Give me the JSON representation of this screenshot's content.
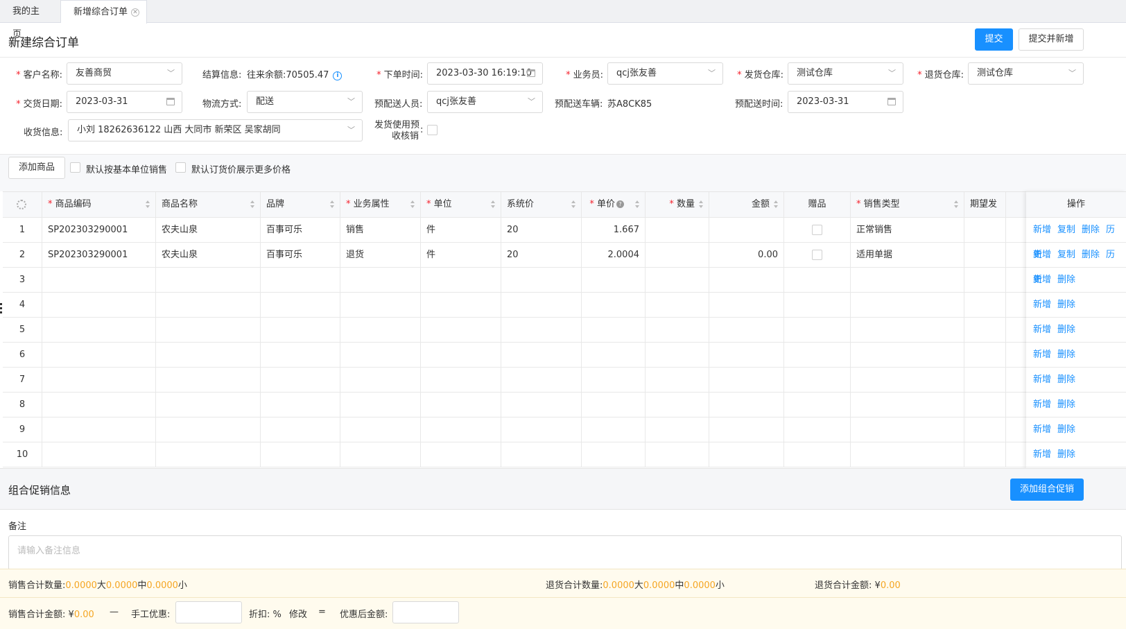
{
  "tabs": [
    {
      "label": "我的主页"
    },
    {
      "label": "新增综合订单",
      "close": "⊗"
    }
  ],
  "header": {
    "title": "新建综合订单",
    "submit_label": "提交",
    "submit_new_label": "提交并新增"
  },
  "form": {
    "customer": {
      "label": "客户名称:",
      "value": "友善商贸"
    },
    "settlement": {
      "label": "结算信息:",
      "value": "往来余额:70505.47"
    },
    "order_time": {
      "label": "下单时间:",
      "value": "2023-03-30 16:19:10"
    },
    "salesperson": {
      "label": "业务员:",
      "value": "qcj张友善"
    },
    "ship_warehouse": {
      "label": "发货仓库:",
      "value": "测试仓库"
    },
    "return_warehouse": {
      "label": "退货仓库:",
      "value": "测试仓库"
    },
    "delivery_date": {
      "label": "交货日期:",
      "value": "2023-03-31"
    },
    "logistics": {
      "label": "物流方式:",
      "value": "配送"
    },
    "delivery_person": {
      "label": "预配送人员:",
      "value": "qcj张友善"
    },
    "vehicle": {
      "label": "预配送车辆:",
      "value": "苏A8CK85"
    },
    "delivery_time": {
      "label": "预配送时间:",
      "value": "2023-03-31"
    },
    "receive_info": {
      "label": "收货信息:",
      "value": "小刘 18262636122 山西 大同市 新荣区 吴家胡同"
    },
    "prepay_label_line1": "发货使用预",
    "prepay_label_line2": "收核销",
    "colon": ":"
  },
  "toolbar": {
    "add_product_label": "添加商品",
    "base_unit_label": "默认按基本单位销售",
    "more_price_label": "默认订货价展示更多价格"
  },
  "table": {
    "headers": {
      "code": "商品编码",
      "name": "商品名称",
      "brand": "品牌",
      "business": "业务属性",
      "unit": "单位",
      "sys_price": "系统价",
      "price": "单价",
      "qty": "数量",
      "amount": "金额",
      "gift": "赠品",
      "sale_type": "销售类型",
      "expect": "期望发",
      "ops": "操作"
    },
    "rows": [
      {
        "no": "1",
        "code": "SP202303290001",
        "name": "农夫山泉",
        "brand": "百事可乐",
        "business": "销售",
        "unit": "件",
        "sys_price": "20",
        "price": "1.667",
        "qty": "",
        "amount": "",
        "sale_type": "正常销售"
      },
      {
        "no": "2",
        "code": "SP202303290001",
        "name": "农夫山泉",
        "brand": "百事可乐",
        "business": "退货",
        "unit": "件",
        "sys_price": "20",
        "price": "2.0004",
        "qty": "",
        "amount": "0.00",
        "sale_type": "适用单据"
      },
      {
        "no": "3"
      },
      {
        "no": "4"
      },
      {
        "no": "5"
      },
      {
        "no": "6"
      },
      {
        "no": "7"
      },
      {
        "no": "8"
      },
      {
        "no": "9"
      },
      {
        "no": "10"
      }
    ],
    "ops": {
      "add": "新增",
      "copy": "复制",
      "delete": "删除",
      "history": "历史"
    }
  },
  "promotion": {
    "title": "组合促销信息",
    "add_label": "添加组合促销"
  },
  "remark": {
    "label": "备注",
    "placeholder": "请输入备注信息"
  },
  "summary": {
    "sale_qty_label": "销售合计数量:",
    "sale_qty": [
      "0.0000",
      "大",
      "0.0000",
      "中",
      "0.0000",
      "小"
    ],
    "return_qty_label": "退货合计数量:",
    "return_qty": [
      "0.0000",
      "大",
      "0.0000",
      "中",
      "0.0000",
      "小"
    ],
    "return_amount_label": "退货合计金额:",
    "return_amount_currency": "¥",
    "return_amount": "0.00",
    "sale_amount_label": "销售合计金额:",
    "sale_amount_currency": "¥",
    "sale_amount": "0.00",
    "minus": "—",
    "manual_discount_label": "手工优惠:",
    "discount_label": "折扣:",
    "percent": "%",
    "modify_label": "修改",
    "equals": "=",
    "after_discount_label": "优惠后金额:"
  },
  "colors": {
    "primary": "#1890ff",
    "required": "#f5222d",
    "amount": "#f5a623"
  }
}
